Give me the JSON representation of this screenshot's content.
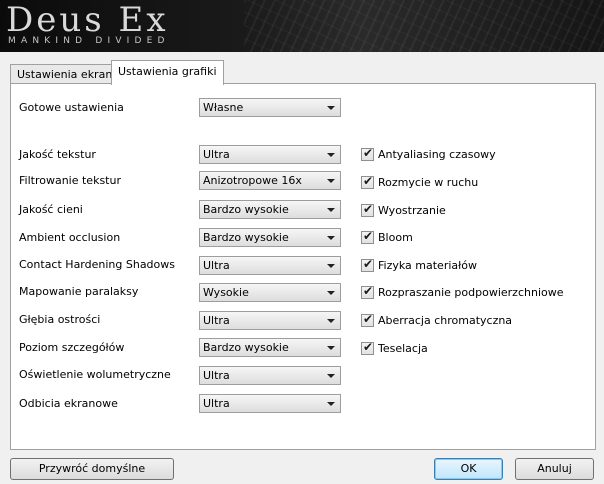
{
  "banner": {
    "title": "Deus Ex",
    "subtitle": "MANKIND DIVIDED"
  },
  "tabs": [
    {
      "label": "Ustawienia ekranu",
      "active": false
    },
    {
      "label": "Ustawienia grafiki",
      "active": true
    }
  ],
  "preset": {
    "label": "Gotowe ustawienia",
    "value": "Własne"
  },
  "settings": [
    {
      "label": "Jakość tekstur",
      "value": "Ultra"
    },
    {
      "label": "Filtrowanie tekstur",
      "value": "Anizotropowe 16x"
    },
    {
      "label": "Jakość cieni",
      "value": "Bardzo wysokie"
    },
    {
      "label": "Ambient occlusion",
      "value": "Bardzo wysokie"
    },
    {
      "label": "Contact Hardening Shadows",
      "value": "Ultra"
    },
    {
      "label": "Mapowanie paralaksy",
      "value": "Wysokie"
    },
    {
      "label": "Głębia ostrości",
      "value": "Ultra"
    },
    {
      "label": "Poziom szczegółów",
      "value": "Bardzo wysokie"
    },
    {
      "label": "Oświetlenie wolumetryczne",
      "value": "Ultra"
    },
    {
      "label": "Odbicia ekranowe",
      "value": "Ultra"
    }
  ],
  "checkboxes": [
    {
      "label": "Antyaliasing czasowy",
      "checked": true
    },
    {
      "label": "Rozmycie w ruchu",
      "checked": true
    },
    {
      "label": "Wyostrzanie",
      "checked": true
    },
    {
      "label": "Bloom",
      "checked": true
    },
    {
      "label": "Fizyka materiałów",
      "checked": true
    },
    {
      "label": "Rozpraszanie podpowierzchniowe",
      "checked": true
    },
    {
      "label": "Aberracja chromatyczna",
      "checked": true
    },
    {
      "label": "Teselacja",
      "checked": true
    }
  ],
  "buttons": {
    "restore": "Przywróć domyślne",
    "ok": "OK",
    "cancel": "Anuluj"
  },
  "check_glyph": "✔"
}
